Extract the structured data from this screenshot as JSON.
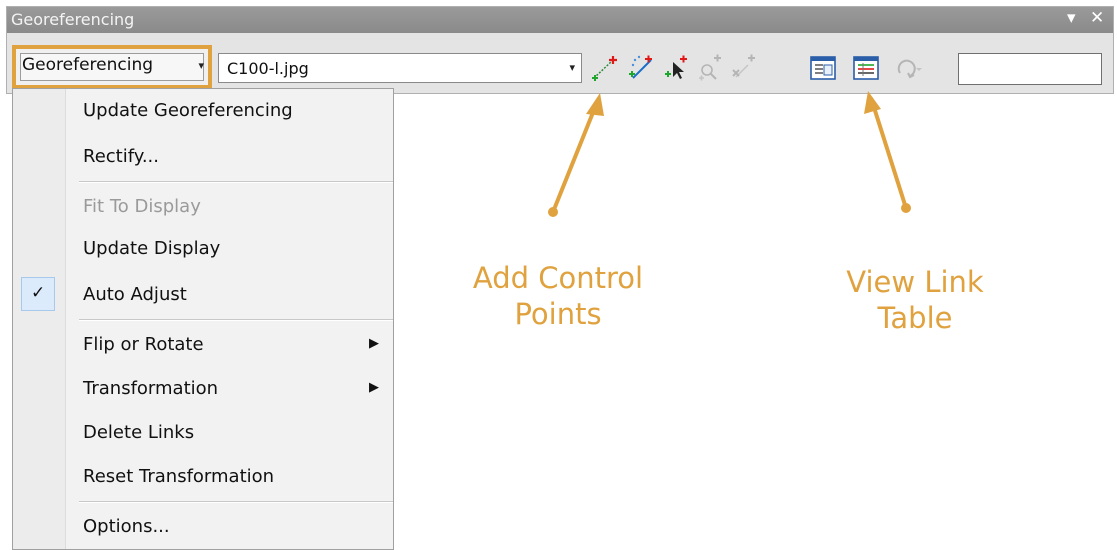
{
  "window": {
    "title": "Georeferencing",
    "controls": {
      "dropdown_glyph": "▾",
      "close_glyph": "✕"
    }
  },
  "toolbar": {
    "menu_button": {
      "label": "Georeferencing",
      "arrow": "▾",
      "highlight_color": "#e0a23e"
    },
    "layer_select": {
      "value": "C100-l.jpg",
      "arrow": "▾"
    },
    "icons": [
      {
        "name": "add-control-points-icon",
        "enabled": true
      },
      {
        "name": "auto-registration-icon",
        "enabled": true
      },
      {
        "name": "select-link-icon",
        "enabled": true
      },
      {
        "name": "zoom-to-selected-link-icon",
        "enabled": false
      },
      {
        "name": "delete-link-icon",
        "enabled": false
      },
      {
        "name": "viewer-icon",
        "enabled": true
      },
      {
        "name": "view-link-table-icon",
        "enabled": true
      },
      {
        "name": "rotate-icon",
        "enabled": false
      }
    ],
    "search_value": ""
  },
  "menu": {
    "items": [
      {
        "label": "Update Georeferencing",
        "enabled": true
      },
      {
        "label": "Rectify...",
        "enabled": true
      },
      {
        "label": "Fit To Display",
        "enabled": false
      },
      {
        "label": "Update Display",
        "enabled": true
      },
      {
        "label": "Auto Adjust",
        "enabled": true,
        "checked": true,
        "check_glyph": "✓"
      },
      {
        "label": "Flip or Rotate",
        "enabled": true,
        "submenu_arrow": "▶"
      },
      {
        "label": "Transformation",
        "enabled": true,
        "submenu_arrow": "▶"
      },
      {
        "label": "Delete Links",
        "enabled": true
      },
      {
        "label": "Reset Transformation",
        "enabled": true
      },
      {
        "label": "Options...",
        "enabled": true
      }
    ]
  },
  "annotations": {
    "color": "#e0a23e",
    "add_control_points": [
      "Add Control",
      "Points"
    ],
    "view_link_table": [
      "View Link",
      "Table"
    ]
  }
}
